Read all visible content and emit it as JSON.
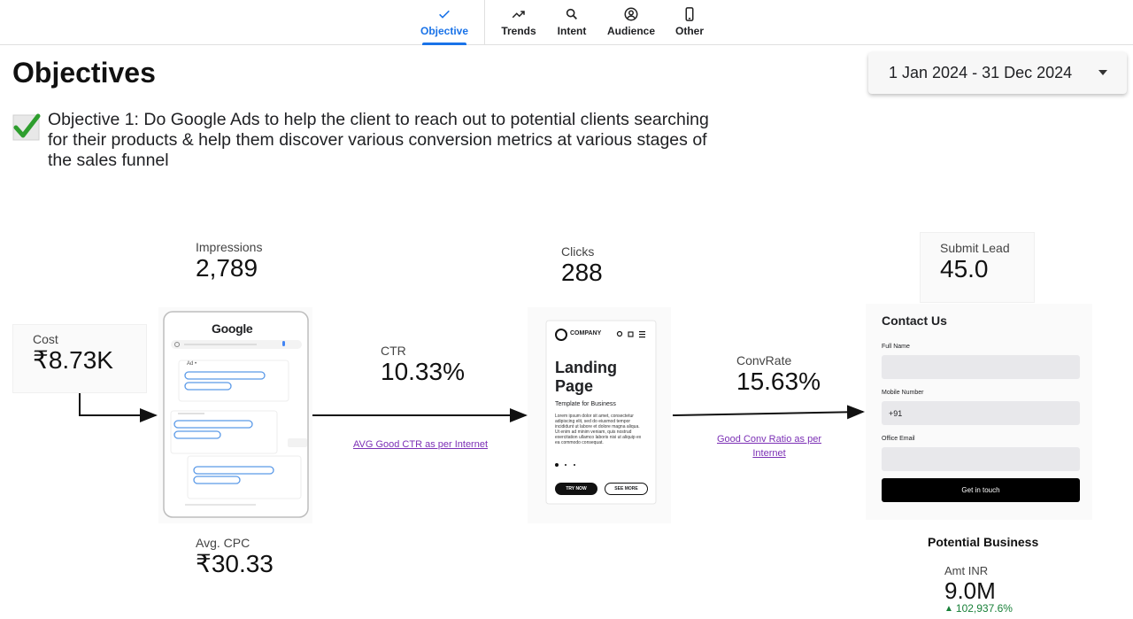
{
  "nav": {
    "tabs": [
      {
        "label": "Objective",
        "icon": "check-icon",
        "active": true
      },
      {
        "label": "Trends",
        "icon": "trending-up-icon"
      },
      {
        "label": "Intent",
        "icon": "search-icon"
      },
      {
        "label": "Audience",
        "icon": "account-circle-icon"
      },
      {
        "label": "Other",
        "icon": "smartphone-icon"
      }
    ]
  },
  "page": {
    "title": "Objectives",
    "date_range": "1 Jan 2024 - 31 Dec 2024",
    "objective_text": "Objective 1: Do Google Ads to help the client to reach out to potential clients searching for their products & help them discover various conversion metrics at various stages of the sales funnel"
  },
  "metrics": {
    "cost": {
      "label": "Cost",
      "value": "₹8.73K"
    },
    "impressions": {
      "label": "Impressions",
      "value": "2,789"
    },
    "avg_cpc": {
      "label": "Avg. CPC",
      "value": "₹30.33"
    },
    "ctr": {
      "label": "CTR",
      "value": "10.33%"
    },
    "clicks": {
      "label": "Clicks",
      "value": "288"
    },
    "conv_rate": {
      "label": "ConvRate",
      "value": "15.63%"
    },
    "submit_lead": {
      "label": "Submit Lead",
      "value": "45.0"
    },
    "potential_business": {
      "title": "Potential Business",
      "label": "Amt INR",
      "value": "9.0M",
      "delta": "102,937.6%"
    }
  },
  "links": {
    "ctr_benchmark": "AVG Good CTR as per Internet",
    "conv_benchmark": "Good Conv Ratio as per Internet"
  },
  "google_card": {
    "logo": "Google",
    "ad_tag": "Ad •"
  },
  "landing_card": {
    "brand": "COMPANY",
    "headline": "Landing Page",
    "subhead": "Template for Business",
    "body": "Lorem ipsum dolor sit amet, consectetur adipiscing elit, sed do eiusmod tempor incididunt ut labore et dolore magna aliqua. Ut enim ad minim veniam, quis nostrud exercitation ullamco laboris nisi ut aliquip ex ea commodo consequat.",
    "btn_primary": "TRY NOW",
    "btn_secondary": "SEE MORE"
  },
  "contact_card": {
    "title": "Contact Us",
    "field1_label": "Full Name",
    "field2_label": "Mobile Number",
    "field2_value": "+91",
    "field3_label": "Office Email",
    "submit": "Get in touch"
  },
  "colors": {
    "accent": "#1a73e8",
    "link": "#7b2fb5",
    "positive": "#188038"
  }
}
